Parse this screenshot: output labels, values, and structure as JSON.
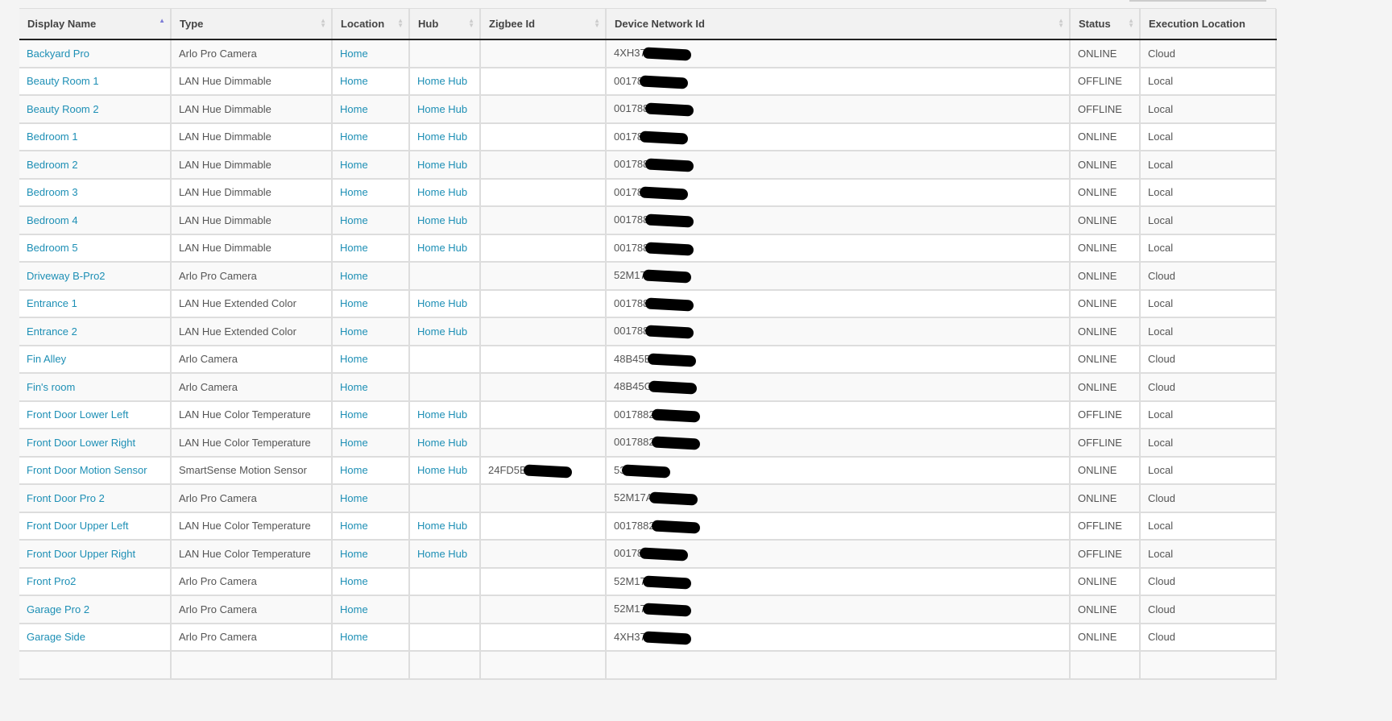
{
  "columns": [
    "Display Name",
    "Type",
    "Location",
    "Hub",
    "Zigbee Id",
    "Device Network Id",
    "Status",
    "Execution Location"
  ],
  "sorted_column": "Display Name",
  "rows": [
    [
      "Backyard Pro",
      "Arlo Pro Camera",
      "Home",
      "",
      "",
      "4XH37",
      "ONLINE",
      "Cloud"
    ],
    [
      "Beauty Room 1",
      "LAN Hue Dimmable",
      "Home",
      "Home Hub",
      "",
      "00178",
      "OFFLINE",
      "Local"
    ],
    [
      "Beauty Room 2",
      "LAN Hue Dimmable",
      "Home",
      "Home Hub",
      "",
      "001788",
      "OFFLINE",
      "Local"
    ],
    [
      "Bedroom 1",
      "LAN Hue Dimmable",
      "Home",
      "Home Hub",
      "",
      "00178",
      "ONLINE",
      "Local"
    ],
    [
      "Bedroom 2",
      "LAN Hue Dimmable",
      "Home",
      "Home Hub",
      "",
      "001788",
      "ONLINE",
      "Local"
    ],
    [
      "Bedroom 3",
      "LAN Hue Dimmable",
      "Home",
      "Home Hub",
      "",
      "00178",
      "ONLINE",
      "Local"
    ],
    [
      "Bedroom 4",
      "LAN Hue Dimmable",
      "Home",
      "Home Hub",
      "",
      "001788",
      "ONLINE",
      "Local"
    ],
    [
      "Bedroom 5",
      "LAN Hue Dimmable",
      "Home",
      "Home Hub",
      "",
      "001788",
      "ONLINE",
      "Local"
    ],
    [
      "Driveway B-Pro2",
      "Arlo Pro Camera",
      "Home",
      "",
      "",
      "52M17",
      "ONLINE",
      "Cloud"
    ],
    [
      "Entrance 1",
      "LAN Hue Extended Color",
      "Home",
      "Home Hub",
      "",
      "001788",
      "ONLINE",
      "Local"
    ],
    [
      "Entrance 2",
      "LAN Hue Extended Color",
      "Home",
      "Home Hub",
      "",
      "001788",
      "ONLINE",
      "Local"
    ],
    [
      "Fin Alley",
      "Arlo Camera",
      "Home",
      "",
      "",
      "48B45B",
      "ONLINE",
      "Cloud"
    ],
    [
      "Fin's room",
      "Arlo Camera",
      "Home",
      "",
      "",
      "48B45C",
      "ONLINE",
      "Cloud"
    ],
    [
      "Front Door Lower Left",
      "LAN Hue Color Temperature",
      "Home",
      "Home Hub",
      "",
      "0017882",
      "OFFLINE",
      "Local"
    ],
    [
      "Front Door Lower Right",
      "LAN Hue Color Temperature",
      "Home",
      "Home Hub",
      "",
      "0017882",
      "OFFLINE",
      "Local"
    ],
    [
      "Front Door Motion Sensor",
      "SmartSense Motion Sensor",
      "Home",
      "Home Hub",
      "24FD5B",
      "53",
      "ONLINE",
      "Local"
    ],
    [
      "Front Door Pro 2",
      "Arlo Pro Camera",
      "Home",
      "",
      "",
      "52M17A",
      "ONLINE",
      "Cloud"
    ],
    [
      "Front Door Upper Left",
      "LAN Hue Color Temperature",
      "Home",
      "Home Hub",
      "",
      "0017882",
      "OFFLINE",
      "Local"
    ],
    [
      "Front Door Upper Right",
      "LAN Hue Color Temperature",
      "Home",
      "Home Hub",
      "",
      "00178",
      "OFFLINE",
      "Local"
    ],
    [
      "Front Pro2",
      "Arlo Pro Camera",
      "Home",
      "",
      "",
      "52M17",
      "ONLINE",
      "Cloud"
    ],
    [
      "Garage Pro 2",
      "Arlo Pro Camera",
      "Home",
      "",
      "",
      "52M17",
      "ONLINE",
      "Cloud"
    ],
    [
      "Garage Side",
      "Arlo Pro Camera",
      "Home",
      "",
      "",
      "4XH37",
      "ONLINE",
      "Cloud"
    ]
  ],
  "colors": {
    "link": "#1d8fb5",
    "sort_active": "#7b7bd6"
  }
}
